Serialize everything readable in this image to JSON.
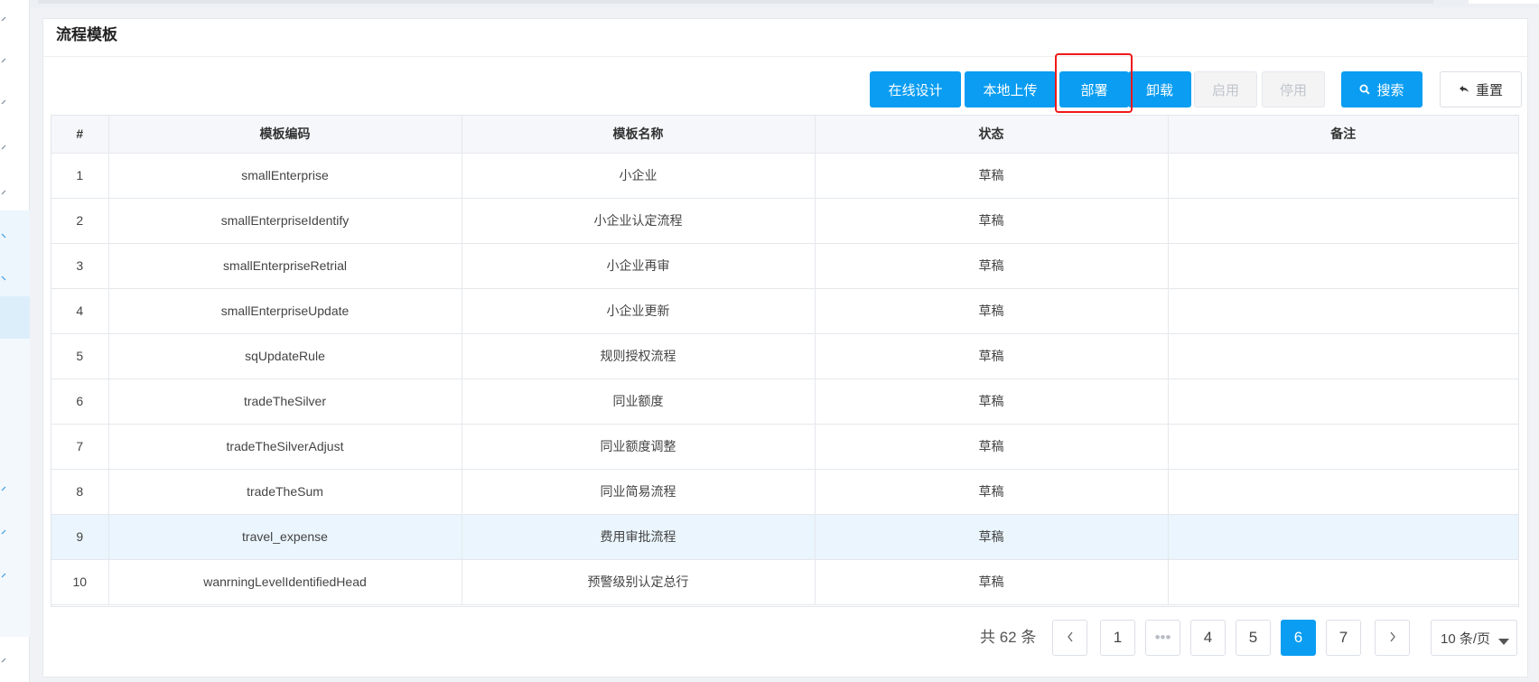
{
  "panel": {
    "title": "流程模板"
  },
  "toolbar": {
    "online_design": "在线设计",
    "local_upload": "本地上传",
    "deploy": "部署",
    "uninstall": "卸载",
    "enable": "启用",
    "disable": "停用",
    "search": "搜索",
    "reset": "重置"
  },
  "table": {
    "headers": [
      "#",
      "模板编码",
      "模板名称",
      "状态",
      "备注"
    ],
    "rows": [
      {
        "num": "1",
        "code": "smallEnterprise",
        "name": "小企业",
        "status": "草稿",
        "remark": ""
      },
      {
        "num": "2",
        "code": "smallEnterpriseIdentify",
        "name": "小企业认定流程",
        "status": "草稿",
        "remark": ""
      },
      {
        "num": "3",
        "code": "smallEnterpriseRetrial",
        "name": "小企业再审",
        "status": "草稿",
        "remark": ""
      },
      {
        "num": "4",
        "code": "smallEnterpriseUpdate",
        "name": "小企业更新",
        "status": "草稿",
        "remark": ""
      },
      {
        "num": "5",
        "code": "sqUpdateRule",
        "name": "规则授权流程",
        "status": "草稿",
        "remark": ""
      },
      {
        "num": "6",
        "code": "tradeTheSilver",
        "name": "同业额度",
        "status": "草稿",
        "remark": ""
      },
      {
        "num": "7",
        "code": "tradeTheSilverAdjust",
        "name": "同业额度调整",
        "status": "草稿",
        "remark": ""
      },
      {
        "num": "8",
        "code": "tradeTheSum",
        "name": "同业简易流程",
        "status": "草稿",
        "remark": ""
      },
      {
        "num": "9",
        "code": "travel_expense",
        "name": "费用审批流程",
        "status": "草稿",
        "remark": ""
      },
      {
        "num": "10",
        "code": "wanrningLevelIdentifiedHead",
        "name": "预警级别认定总行",
        "status": "草稿",
        "remark": ""
      }
    ],
    "selected_row": "9"
  },
  "pager": {
    "total": "共 62 条",
    "pages": [
      "1",
      "•••",
      "4",
      "5",
      "6",
      "7"
    ],
    "current": "6",
    "page_size": "10 条/页"
  },
  "colors": {
    "primary": "#0a9df2",
    "highlight_box": "#f01919",
    "selected_row": "#eaf5fd"
  },
  "icons": {
    "search": "search-icon",
    "reset": "back-arrow-icon",
    "prev": "chevron-left-icon",
    "next": "chevron-right-icon",
    "page_size": "caret-down-icon",
    "sidebar": "chevron-icon"
  }
}
